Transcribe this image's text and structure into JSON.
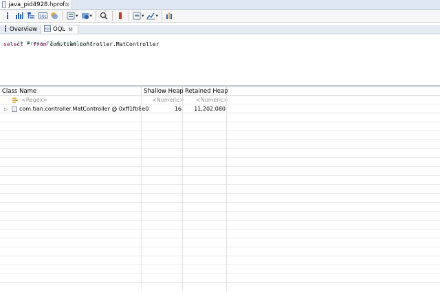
{
  "editor_tab": {
    "label": "java_pid4928.hprof",
    "close": "⊠"
  },
  "toolbar": {
    "buttons": [
      {
        "icon": "info-icon"
      },
      {
        "icon": "histogram-icon"
      },
      {
        "icon": "dominator-tree-icon"
      },
      {
        "icon": "oql-icon"
      },
      {
        "icon": "heap-dump-overview-icon"
      },
      {
        "icon": "query-browser-icon",
        "dropdown": true
      },
      {
        "icon": "find-object-icon"
      },
      {
        "icon": "run-expert-system-icon"
      },
      {
        "icon": "open-query-icon",
        "dropdown": true
      },
      {
        "icon": "export-icon",
        "dropdown": true
      },
      {
        "icon": "calculate-retained-icon"
      }
    ],
    "dropdown_glyph": "▾"
  },
  "view_tabs": [
    {
      "label": "Overview",
      "icon": "info-icon",
      "active": false
    },
    {
      "label": "OQL",
      "icon": "oql-icon",
      "active": true,
      "close": "⊠"
    }
  ],
  "editor": {
    "comment": "/* Press F1 for help */",
    "keyword_select": "select",
    "star": " * ",
    "keyword_from": "from",
    "rest": " com.tian.controller.MatController"
  },
  "table": {
    "headers": {
      "name": "Class Name",
      "shallow": "Shallow Heap",
      "retained": "Retained Heap"
    },
    "filter_row": {
      "name": "<Regex>",
      "shallow": "<Numeric>",
      "retained": "<Numeric>"
    },
    "rows": [
      {
        "name": "com.tian.controller.MatController @ 0xff1fb8e0",
        "shallow": "16",
        "retained": "11,202,080"
      }
    ],
    "toggle_glyph": "▷"
  },
  "colors": {
    "accent": "#dfe7f3",
    "keyword": "#7f0055",
    "comment": "#4a8a6e"
  }
}
